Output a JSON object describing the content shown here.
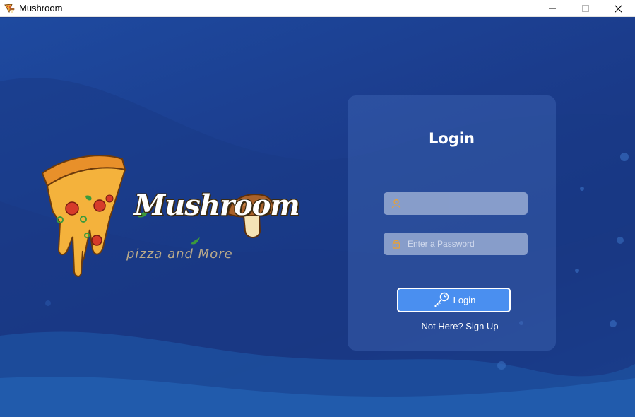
{
  "window": {
    "title": "Mushroom",
    "minimize_icon": "minimize-icon",
    "maximize_icon": "maximize-icon",
    "close_icon": "close-icon"
  },
  "logo": {
    "wordmark": "Mushroom",
    "tagline": "pizza and More",
    "icons": [
      "pizza-slice-icon",
      "mushroom-icon"
    ]
  },
  "login": {
    "title": "Login",
    "username": {
      "value": "",
      "placeholder": "",
      "icon": "user-icon"
    },
    "password": {
      "value": "",
      "placeholder": "Enter a Password",
      "icon": "lock-icon"
    },
    "button_label": "Login",
    "button_icon": "key-icon",
    "signup_link": "Not Here? Sign Up"
  },
  "colors": {
    "background": "#1b3f8f",
    "panel": "#3d66b3",
    "field": "#8fa4cf",
    "button": "#4a8ff0",
    "icon_accent": "#f0a83a"
  }
}
